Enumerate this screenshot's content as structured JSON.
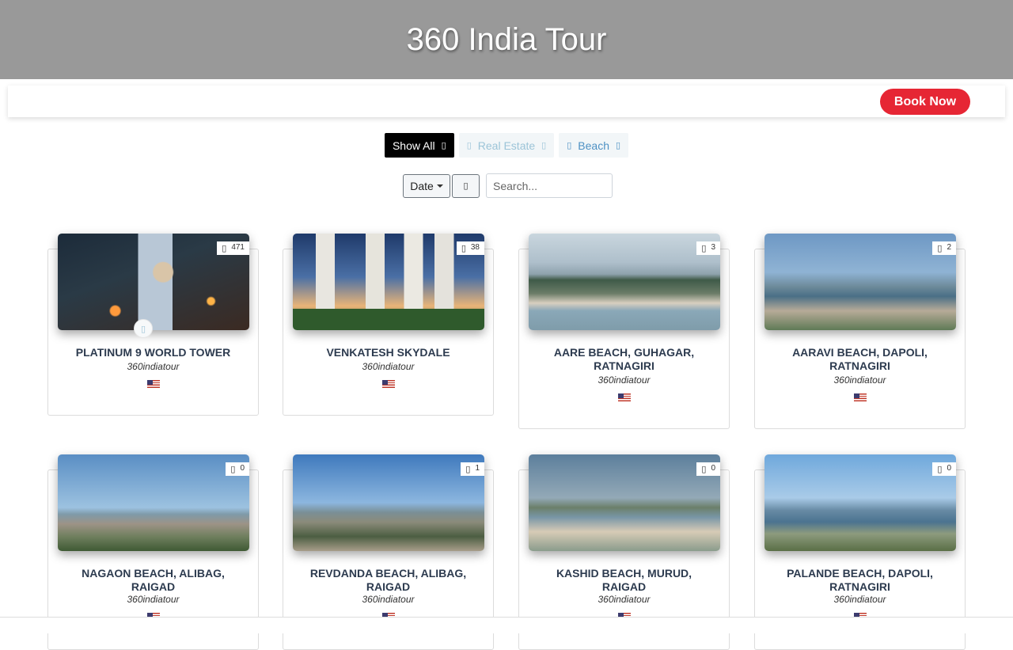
{
  "header": {
    "title": "360 India Tour"
  },
  "topbar": {
    "book_label": "Book Now"
  },
  "filters": [
    {
      "label": "Show All",
      "icon": "list-icon"
    },
    {
      "label": "Real Estate",
      "icon": "building-icon"
    },
    {
      "label": "Beach",
      "icon": "umbrella-icon"
    }
  ],
  "tools": {
    "sort_selected": "Date",
    "search_placeholder": "Search..."
  },
  "cards": [
    {
      "title": "PLATINUM 9 WORLD TOWER",
      "author": "360indiatour",
      "count": "471",
      "flag": "us-flag"
    },
    {
      "title": "VENKATESH SKYDALE",
      "author": "360indiatour",
      "count": "38",
      "flag": "us-flag"
    },
    {
      "title": "AARE BEACH, GUHAGAR, RATNAGIRI",
      "author": "360indiatour",
      "count": "3",
      "flag": "us-flag"
    },
    {
      "title": "AARAVI BEACH, DAPOLI, RATNAGIRI",
      "author": "360indiatour",
      "count": "2",
      "flag": "us-flag"
    },
    {
      "title": "NAGAON BEACH, ALIBAG, RAIGAD",
      "author": "360indiatour",
      "count": "0",
      "flag": "us-flag"
    },
    {
      "title": "REVDANDA BEACH, ALIBAG, RAIGAD",
      "author": "360indiatour",
      "count": "1",
      "flag": "us-flag"
    },
    {
      "title": "KASHID BEACH, MURUD, RAIGAD",
      "author": "360indiatour",
      "count": "0",
      "flag": "us-flag"
    },
    {
      "title": "PALANDE BEACH, DAPOLI, RATNAGIRI",
      "author": "360indiatour",
      "count": "0",
      "flag": "us-flag"
    }
  ]
}
